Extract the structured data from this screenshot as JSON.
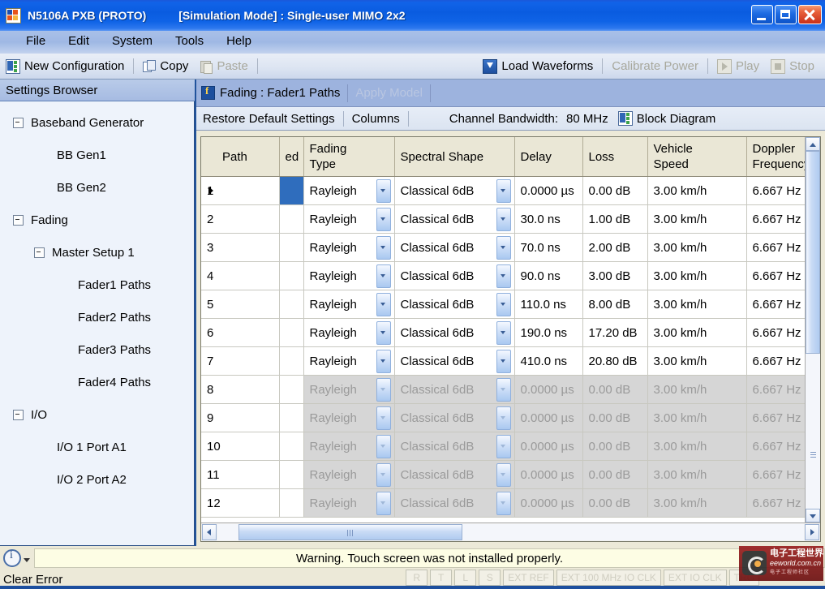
{
  "window": {
    "app_icon": "app-grid-icon",
    "title": "N5106A PXB (PROTO)",
    "subtitle": "[Simulation Mode] : Single-user MIMO 2x2",
    "minimize_label": "Minimize",
    "maximize_label": "Maximize",
    "close_label": "Close"
  },
  "menu": {
    "items": [
      {
        "label": "File"
      },
      {
        "label": "Edit"
      },
      {
        "label": "System"
      },
      {
        "label": "Tools"
      },
      {
        "label": "Help"
      }
    ]
  },
  "toolbar": {
    "new_configuration": "New Configuration",
    "copy": "Copy",
    "paste": "Paste",
    "load_waveforms": "Load Waveforms",
    "calibrate_power": "Calibrate Power",
    "play": "Play",
    "stop": "Stop"
  },
  "sidebar": {
    "header": "Settings Browser",
    "items": [
      {
        "label": "Baseband Generator",
        "level": 0,
        "expander": true
      },
      {
        "label": "BB Gen1",
        "level": 2,
        "expander": false
      },
      {
        "label": "BB Gen2",
        "level": 2,
        "expander": false
      },
      {
        "label": "Fading",
        "level": 0,
        "expander": true
      },
      {
        "label": "Master Setup 1",
        "level": 1,
        "expander": true
      },
      {
        "label": "Fader1 Paths",
        "level": 3,
        "expander": false
      },
      {
        "label": "Fader2 Paths",
        "level": 3,
        "expander": false
      },
      {
        "label": "Fader3 Paths",
        "level": 3,
        "expander": false
      },
      {
        "label": "Fader4 Paths",
        "level": 3,
        "expander": false
      },
      {
        "label": "I/O",
        "level": 0,
        "expander": true
      },
      {
        "label": "I/O 1 Port A1",
        "level": 2,
        "expander": false
      },
      {
        "label": "I/O 2 Port A2",
        "level": 2,
        "expander": false
      }
    ]
  },
  "panel": {
    "title": "Fading : Fader1 Paths",
    "apply_model": "Apply Model",
    "restore_defaults": "Restore Default Settings",
    "columns": "Columns",
    "channel_bandwidth_label": "Channel Bandwidth:",
    "channel_bandwidth_value": "80 MHz",
    "block_diagram": "Block Diagram"
  },
  "grid": {
    "columns": [
      {
        "key": "path",
        "label": "Path"
      },
      {
        "key": "enabled",
        "label": "ed"
      },
      {
        "key": "fading_type",
        "label": "Fading\nType"
      },
      {
        "key": "spectral_shape",
        "label": "Spectral Shape"
      },
      {
        "key": "delay",
        "label": "Delay"
      },
      {
        "key": "loss",
        "label": "Loss"
      },
      {
        "key": "vehicle_speed",
        "label": "Vehicle\nSpeed"
      },
      {
        "key": "doppler",
        "label": "Doppler\nFrequency"
      }
    ],
    "rows": [
      {
        "path": "1",
        "selected": true,
        "enabled_selected": true,
        "fading_type": "Rayleigh",
        "spectral_shape": "Classical 6dB",
        "delay": "0.0000 µs",
        "loss": "0.00 dB",
        "vehicle_speed": "3.00 km/h",
        "doppler": "6.667 Hz",
        "disabled": false
      },
      {
        "path": "2",
        "selected": false,
        "enabled_selected": false,
        "fading_type": "Rayleigh",
        "spectral_shape": "Classical 6dB",
        "delay": "30.0 ns",
        "loss": "1.00 dB",
        "vehicle_speed": "3.00 km/h",
        "doppler": "6.667 Hz",
        "disabled": false
      },
      {
        "path": "3",
        "selected": false,
        "enabled_selected": false,
        "fading_type": "Rayleigh",
        "spectral_shape": "Classical 6dB",
        "delay": "70.0 ns",
        "loss": "2.00 dB",
        "vehicle_speed": "3.00 km/h",
        "doppler": "6.667 Hz",
        "disabled": false
      },
      {
        "path": "4",
        "selected": false,
        "enabled_selected": false,
        "fading_type": "Rayleigh",
        "spectral_shape": "Classical 6dB",
        "delay": "90.0 ns",
        "loss": "3.00 dB",
        "vehicle_speed": "3.00 km/h",
        "doppler": "6.667 Hz",
        "disabled": false
      },
      {
        "path": "5",
        "selected": false,
        "enabled_selected": false,
        "fading_type": "Rayleigh",
        "spectral_shape": "Classical 6dB",
        "delay": "110.0 ns",
        "loss": "8.00 dB",
        "vehicle_speed": "3.00 km/h",
        "doppler": "6.667 Hz",
        "disabled": false
      },
      {
        "path": "6",
        "selected": false,
        "enabled_selected": false,
        "fading_type": "Rayleigh",
        "spectral_shape": "Classical 6dB",
        "delay": "190.0 ns",
        "loss": "17.20 dB",
        "vehicle_speed": "3.00 km/h",
        "doppler": "6.667 Hz",
        "disabled": false
      },
      {
        "path": "7",
        "selected": false,
        "enabled_selected": false,
        "fading_type": "Rayleigh",
        "spectral_shape": "Classical 6dB",
        "delay": "410.0 ns",
        "loss": "20.80 dB",
        "vehicle_speed": "3.00 km/h",
        "doppler": "6.667 Hz",
        "disabled": false
      },
      {
        "path": "8",
        "selected": false,
        "enabled_selected": false,
        "fading_type": "Rayleigh",
        "spectral_shape": "Classical 6dB",
        "delay": "0.0000 µs",
        "loss": "0.00 dB",
        "vehicle_speed": "3.00 km/h",
        "doppler": "6.667 Hz",
        "disabled": true
      },
      {
        "path": "9",
        "selected": false,
        "enabled_selected": false,
        "fading_type": "Rayleigh",
        "spectral_shape": "Classical 6dB",
        "delay": "0.0000 µs",
        "loss": "0.00 dB",
        "vehicle_speed": "3.00 km/h",
        "doppler": "6.667 Hz",
        "disabled": true
      },
      {
        "path": "10",
        "selected": false,
        "enabled_selected": false,
        "fading_type": "Rayleigh",
        "spectral_shape": "Classical 6dB",
        "delay": "0.0000 µs",
        "loss": "0.00 dB",
        "vehicle_speed": "3.00 km/h",
        "doppler": "6.667 Hz",
        "disabled": true
      },
      {
        "path": "11",
        "selected": false,
        "enabled_selected": false,
        "fading_type": "Rayleigh",
        "spectral_shape": "Classical 6dB",
        "delay": "0.0000 µs",
        "loss": "0.00 dB",
        "vehicle_speed": "3.00 km/h",
        "doppler": "6.667 Hz",
        "disabled": true
      },
      {
        "path": "12",
        "selected": false,
        "enabled_selected": false,
        "fading_type": "Rayleigh",
        "spectral_shape": "Classical 6dB",
        "delay": "0.0000 µs",
        "loss": "0.00 dB",
        "vehicle_speed": "3.00 km/h",
        "doppler": "6.667 Hz",
        "disabled": true
      }
    ]
  },
  "statusbar": {
    "error_message": "Warning. Touch screen was not installed properly.",
    "clear_error": "Clear Error",
    "indicators": [
      {
        "label": "R",
        "small": true
      },
      {
        "label": "T",
        "small": true
      },
      {
        "label": "L",
        "small": true
      },
      {
        "label": "S",
        "small": true
      },
      {
        "label": "EXT REF",
        "small": false
      },
      {
        "label": "EXT 100 MHz IO CLK",
        "small": false
      },
      {
        "label": "EXT IO CLK",
        "small": false
      },
      {
        "label": "TRG",
        "small": false
      }
    ],
    "watermark": {
      "line1": "电子工程世界",
      "line2": "eeworld.com.cn",
      "line3": "电子工程师社区"
    }
  },
  "colors": {
    "titlebar_blue": "#0a5ce0",
    "panel_header": "#9db3de",
    "selection_blue": "#2f6dbd",
    "grid_header": "#eae7d6",
    "sidebar_bg": "#eef3fb",
    "error_field": "#fdfde4"
  }
}
